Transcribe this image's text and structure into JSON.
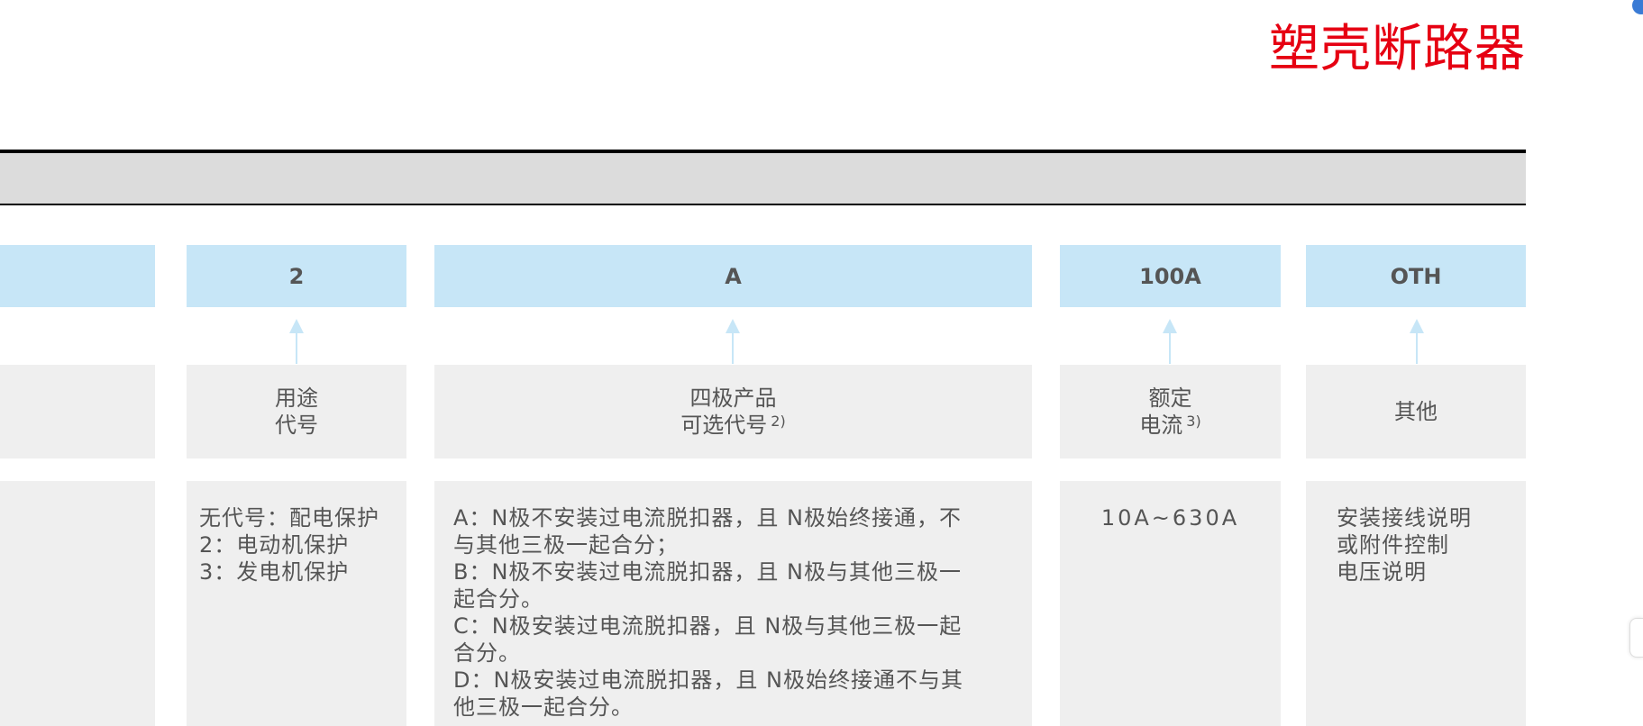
{
  "title": "塑壳断路器",
  "columns": [
    {
      "code": "2",
      "label_lines": [
        "用途",
        "代号"
      ],
      "label_note": "",
      "detail_lines": [
        "无代号：配电保护",
        "2：电动机保护",
        "3：发电机保护"
      ]
    },
    {
      "code": "A",
      "label_lines": [
        "四极产品",
        "可选代号"
      ],
      "label_note": "2)",
      "detail_lines": [
        "A：N极不安装过电流脱扣器，且 N极始终接通，不",
        "与其他三极一起合分；",
        "B：N极不安装过电流脱扣器，且 N极与其他三极一",
        "起合分。",
        "C：N极安装过电流脱扣器，且 N极与其他三极一起",
        "合分。",
        "D：N极安装过电流脱扣器，且 N极始终接通不与其",
        "他三极一起合分。"
      ]
    },
    {
      "code": "100A",
      "label_lines": [
        "额定",
        "电流"
      ],
      "label_note": "3)",
      "detail_lines": [
        "10A~630A"
      ]
    },
    {
      "code": "OTH",
      "label_lines": [
        "其他"
      ],
      "label_note": "",
      "detail_lines": [
        "安装接线说明",
        "或附件控制",
        "电压说明"
      ]
    }
  ],
  "colors": {
    "accent": "#e60012",
    "header_fill": "#c7e6f7",
    "cell_fill": "#efefef",
    "arrow": "#c7e6f7"
  }
}
